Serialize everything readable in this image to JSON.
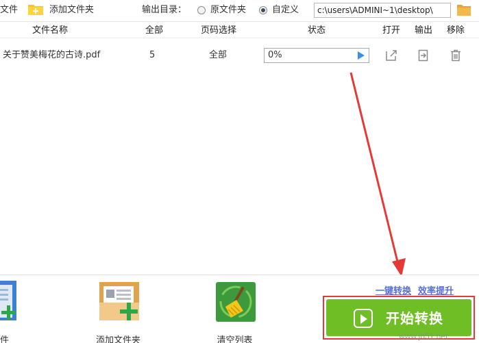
{
  "toolbar": {
    "add_file_label": "文件",
    "add_folder_label": "添加文件夹",
    "output_dir_label": "输出目录：",
    "radio_original_label": "原文件夹",
    "radio_custom_label": "自定义",
    "selected_output": "custom",
    "output_path": "c:\\users\\ADMINI~1\\desktop\\"
  },
  "table": {
    "columns": [
      "文件名称",
      "全部",
      "页码选择",
      "状态",
      "打开",
      "输出",
      "移除"
    ],
    "rows": [
      {
        "file_name": "关于赞美梅花的古诗.pdf",
        "total_pages": "5",
        "page_selection": "全部",
        "status_text": "0%",
        "progress": 0
      }
    ]
  },
  "bottom": {
    "add_file_label": "文件",
    "add_folder_label": "添加文件夹",
    "clear_list_label": "清空列表",
    "promo_left": "一键转换",
    "promo_right": "效率提升",
    "start_label": "开始转换"
  },
  "watermark": "www.jb51.net",
  "colors": {
    "start_green": "#6fbe26",
    "annotation_red": "#e53935",
    "progress_arrow": "#3a8fe0",
    "promo_link": "#5a6fd6"
  }
}
